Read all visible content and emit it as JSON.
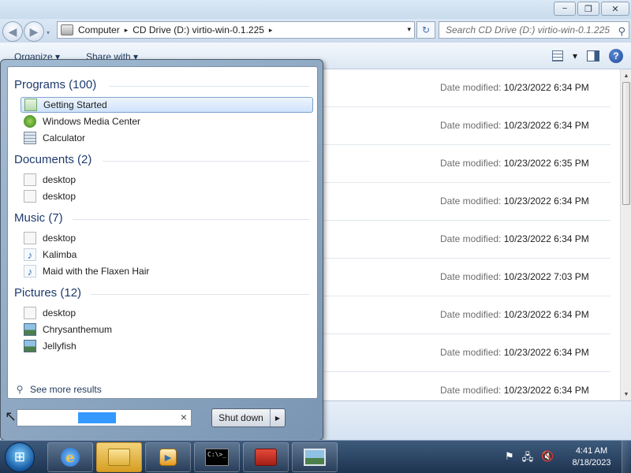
{
  "explorer": {
    "window_controls": {
      "minimize": "−",
      "restore": "❐",
      "close": "✕"
    },
    "nav": {
      "back": "◀",
      "forward": "▶",
      "dropdown": "▾"
    },
    "breadcrumbs": [
      "Computer",
      "CD Drive (D:) virtio-win-0.1.225"
    ],
    "breadcrumb_separator": "▸",
    "refresh_icon": "↻",
    "search_placeholder": "Search CD Drive (D:) virtio-win-0.1.225",
    "commands": {
      "organize": "Organize ▾",
      "share": "Share with ▾"
    },
    "toolbar_right": {
      "views_drop": "▾",
      "help": "?"
    },
    "scroll": {
      "up": "▲",
      "down": "▼"
    },
    "date_label": "Date modified:",
    "rows": [
      "10/23/2022 6:34 PM",
      "10/23/2022 6:34 PM",
      "10/23/2022 6:35 PM",
      "10/23/2022 6:34 PM",
      "10/23/2022 6:34 PM",
      "10/23/2022 7:03 PM",
      "10/23/2022 6:34 PM",
      "10/23/2022 6:34 PM",
      "10/23/2022 6:34 PM"
    ]
  },
  "start_menu": {
    "groups": [
      {
        "header": "Programs (100)",
        "items": [
          {
            "label": "Getting Started",
            "icon": "getting-started-icon",
            "selected": true
          },
          {
            "label": "Windows Media Center",
            "icon": "media-center-icon"
          },
          {
            "label": "Calculator",
            "icon": "calculator-icon"
          }
        ]
      },
      {
        "header": "Documents (2)",
        "items": [
          {
            "label": "desktop",
            "icon": "document-icon"
          },
          {
            "label": "desktop",
            "icon": "document-icon"
          }
        ]
      },
      {
        "header": "Music (7)",
        "items": [
          {
            "label": "desktop",
            "icon": "document-icon"
          },
          {
            "label": "Kalimba",
            "icon": "music-note-icon"
          },
          {
            "label": "Maid with the Flaxen Hair",
            "icon": "music-note-icon"
          }
        ]
      },
      {
        "header": "Pictures (12)",
        "items": [
          {
            "label": "desktop",
            "icon": "document-icon"
          },
          {
            "label": "Chrysanthemum",
            "icon": "picture-icon"
          },
          {
            "label": "Jellyfish",
            "icon": "picture-icon"
          }
        ]
      }
    ],
    "see_more": "See more results",
    "search_icon": "⚲",
    "search_clear": "×",
    "shutdown": {
      "label": "Shut down",
      "arrow": "▶"
    },
    "cursor": "↖"
  },
  "taskbar": {
    "start_glyph": "⊞",
    "ie_glyph": "e",
    "media_glyph": "▶",
    "cmd_text": "C:\\>_",
    "tray": {
      "flag": "⚑",
      "network": "🖧",
      "volume": "🔇"
    },
    "time": "4:41 AM",
    "date": "8/18/2023"
  }
}
